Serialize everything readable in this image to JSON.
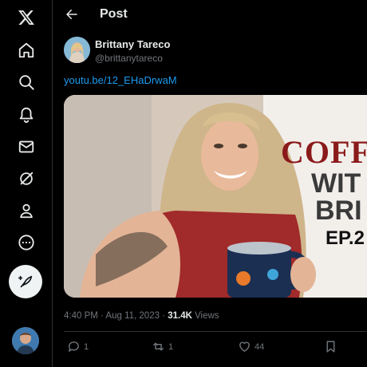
{
  "app": {
    "logo_icon": "x-logo-icon"
  },
  "nav": [
    {
      "name": "home",
      "icon": "home-icon"
    },
    {
      "name": "explore",
      "icon": "search-icon"
    },
    {
      "name": "notifications",
      "icon": "bell-icon"
    },
    {
      "name": "messages",
      "icon": "mail-icon"
    },
    {
      "name": "grok",
      "icon": "grok-icon"
    },
    {
      "name": "profile",
      "icon": "person-icon"
    },
    {
      "name": "more",
      "icon": "more-icon"
    }
  ],
  "header": {
    "title": "Post"
  },
  "post": {
    "author_name": "Brittany Tareco",
    "author_handle": "@brittanytareco",
    "link_text": "youtu.be/12_EHaDrwaM",
    "thumbnail": {
      "text_line1": "COFF",
      "text_line2": "WIT",
      "text_line3": "BRI",
      "text_line4": "EP.2"
    },
    "time": "4:40 PM · Aug 11, 2023 · ",
    "views_count": "31.4K",
    "views_label": " Views",
    "replies": "1",
    "reposts": "1",
    "likes": "44"
  },
  "colors": {
    "background": "#000000",
    "accent": "#1d9bf0",
    "muted": "#71767b",
    "thumbnail_text": "#8b1a1a"
  }
}
